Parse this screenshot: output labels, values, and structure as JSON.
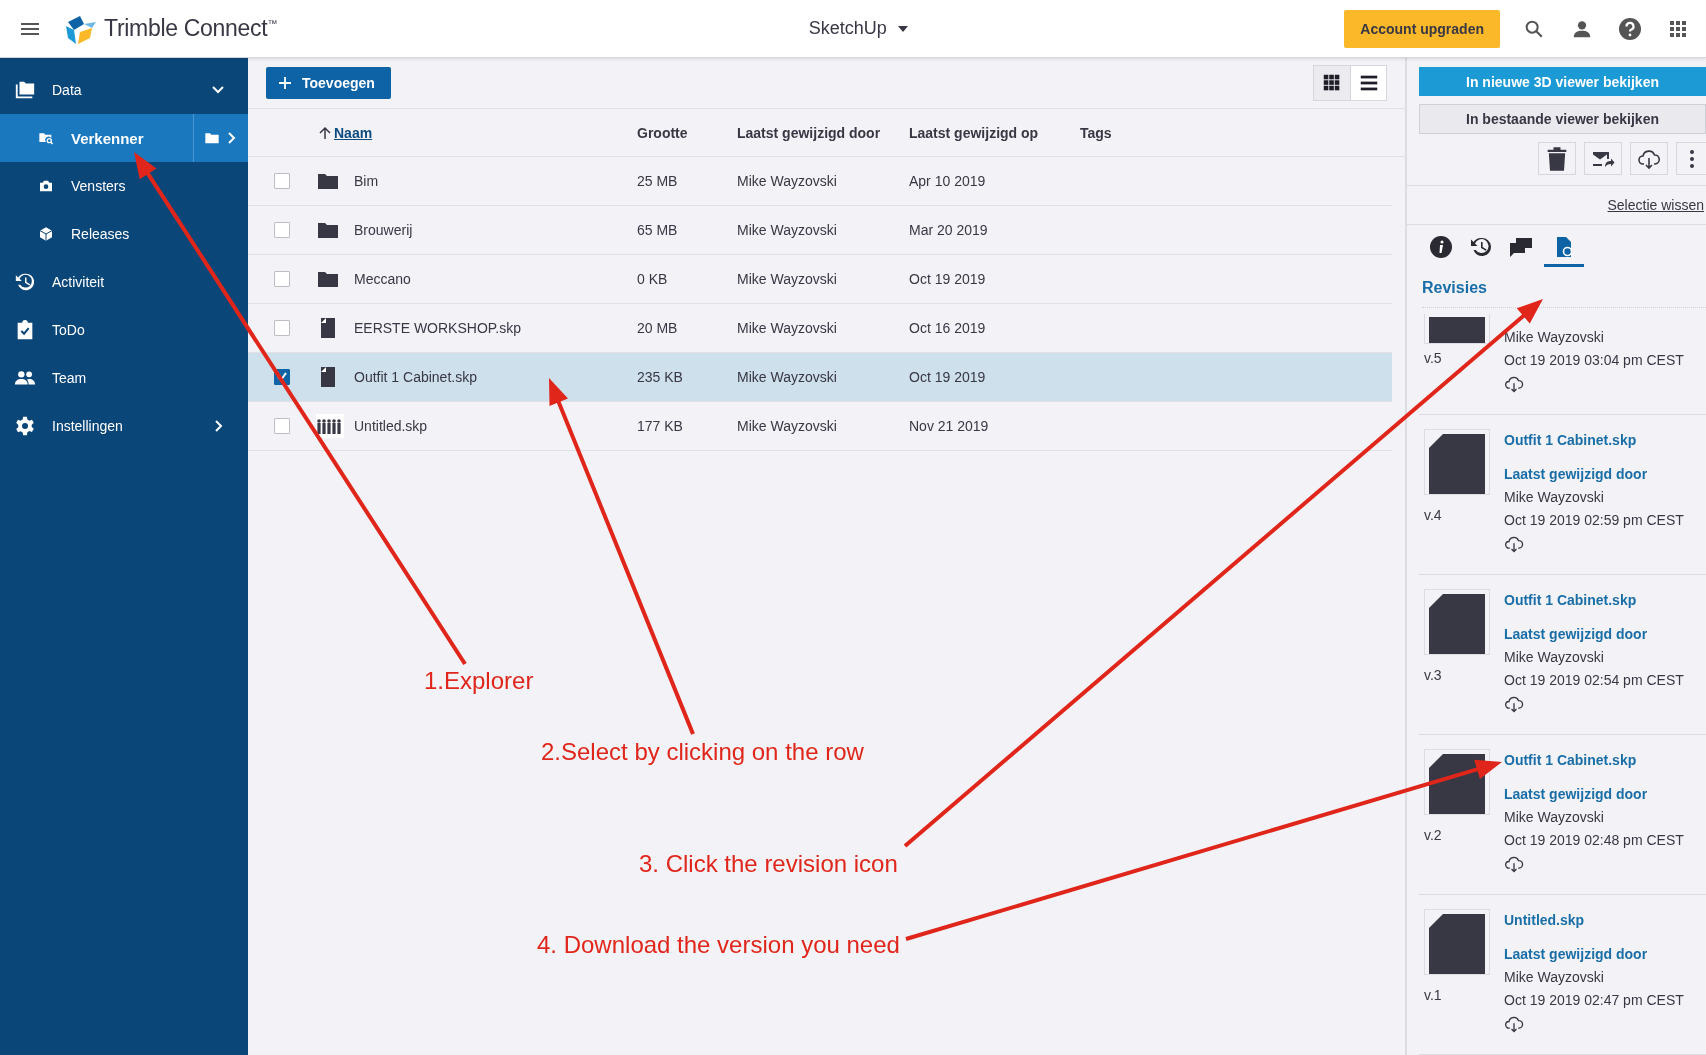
{
  "topbar": {
    "app_name": "Trimble Connect$^{™}$",
    "project": "SketchUp",
    "upgrade_button": "Account upgraden"
  },
  "sidebar": {
    "items": [
      {
        "label": "Data",
        "kind": "folders",
        "selected": false,
        "expanded": true,
        "children": [
          {
            "label": "Verkenner",
            "kind": "folder-search",
            "selected": true
          },
          {
            "label": "Vensters",
            "kind": "camera",
            "selected": false
          },
          {
            "label": "Releases",
            "kind": "package",
            "selected": false
          }
        ]
      },
      {
        "label": "Activiteit",
        "kind": "history",
        "selected": false
      },
      {
        "label": "ToDo",
        "kind": "clipboard",
        "selected": false
      },
      {
        "label": "Team",
        "kind": "people",
        "selected": false
      },
      {
        "label": "Instellingen",
        "kind": "gear",
        "selected": false,
        "expanded": false
      }
    ]
  },
  "toolbar": {
    "add_button": "Toevoegen",
    "views": [
      {
        "kind": "grid",
        "selected": false
      },
      {
        "kind": "list",
        "selected": true
      }
    ]
  },
  "table": {
    "columns": [
      "Naam",
      "Grootte",
      "Laatst gewijzigd door",
      "Laatst gewijzigd op",
      "Tags"
    ],
    "rows": [
      {
        "kind": "folder",
        "name": "Bim",
        "size": "25 MB",
        "modified_by": "Mike Wayzovski",
        "modified_on": "Apr 10 2019",
        "selected": false
      },
      {
        "kind": "folder",
        "name": "Brouwerij",
        "size": "65 MB",
        "modified_by": "Mike Wayzovski",
        "modified_on": "Mar 20 2019",
        "selected": false
      },
      {
        "kind": "folder",
        "name": "Meccano",
        "size": "0 KB",
        "modified_by": "Mike Wayzovski",
        "modified_on": "Oct 19 2019",
        "selected": false
      },
      {
        "kind": "file",
        "name": "EERSTE WORKSHOP.skp",
        "size": "20 MB",
        "modified_by": "Mike Wayzovski",
        "modified_on": "Oct 16 2019",
        "selected": false
      },
      {
        "kind": "file",
        "name": "Outfit 1 Cabinet.skp",
        "size": "235 KB",
        "modified_by": "Mike Wayzovski",
        "modified_on": "Oct 19 2019",
        "selected": true
      },
      {
        "kind": "model",
        "name": "Untitled.skp",
        "size": "177 KB",
        "modified_by": "Mike Wayzovski",
        "modified_on": "Nov 21 2019",
        "selected": false
      }
    ]
  },
  "details": {
    "primary_button": "In nieuwe 3D viewer bekijken",
    "secondary_button": "In bestaande viewer bekijken",
    "actions": [
      {
        "kind": "delete"
      },
      {
        "kind": "share"
      },
      {
        "kind": "download"
      },
      {
        "kind": "more"
      }
    ],
    "clear_link": "Selectie wissen",
    "tabs": [
      {
        "kind": "info",
        "selected": false
      },
      {
        "kind": "history",
        "selected": false
      },
      {
        "kind": "comments",
        "selected": false
      },
      {
        "kind": "revisions",
        "selected": true
      }
    ],
    "section_title": "Revisies",
    "revisions": [
      {
        "kind": "partial",
        "version": "v.5",
        "author": "Mike Wayzovski",
        "date": "Oct 19 2019 03:04 pm CEST"
      },
      {
        "kind": "full",
        "file": "Outfit 1 Cabinet.skp",
        "label": "Laatst gewijzigd door",
        "author": "Mike Wayzovski",
        "date": "Oct 19 2019 02:59 pm CEST",
        "version": "v.4"
      },
      {
        "kind": "full",
        "file": "Outfit 1 Cabinet.skp",
        "label": "Laatst gewijzigd door",
        "author": "Mike Wayzovski",
        "date": "Oct 19 2019 02:54 pm CEST",
        "version": "v.3"
      },
      {
        "kind": "full",
        "file": "Outfit 1 Cabinet.skp",
        "label": "Laatst gewijzigd door",
        "author": "Mike Wayzovski",
        "date": "Oct 19 2019 02:48 pm CEST",
        "version": "v.2"
      },
      {
        "kind": "full",
        "file": "Untitled.skp",
        "label": "Laatst gewijzigd door",
        "author": "Mike Wayzovski",
        "date": "Oct 19 2019 02:47 pm CEST",
        "version": "v.1"
      }
    ]
  },
  "annotations": [
    {
      "text": "1.Explorer"
    },
    {
      "text": "2.Select by clicking on the row"
    },
    {
      "text": "3. Click the revision icon"
    },
    {
      "text": "4. Download the version you need"
    }
  ]
}
